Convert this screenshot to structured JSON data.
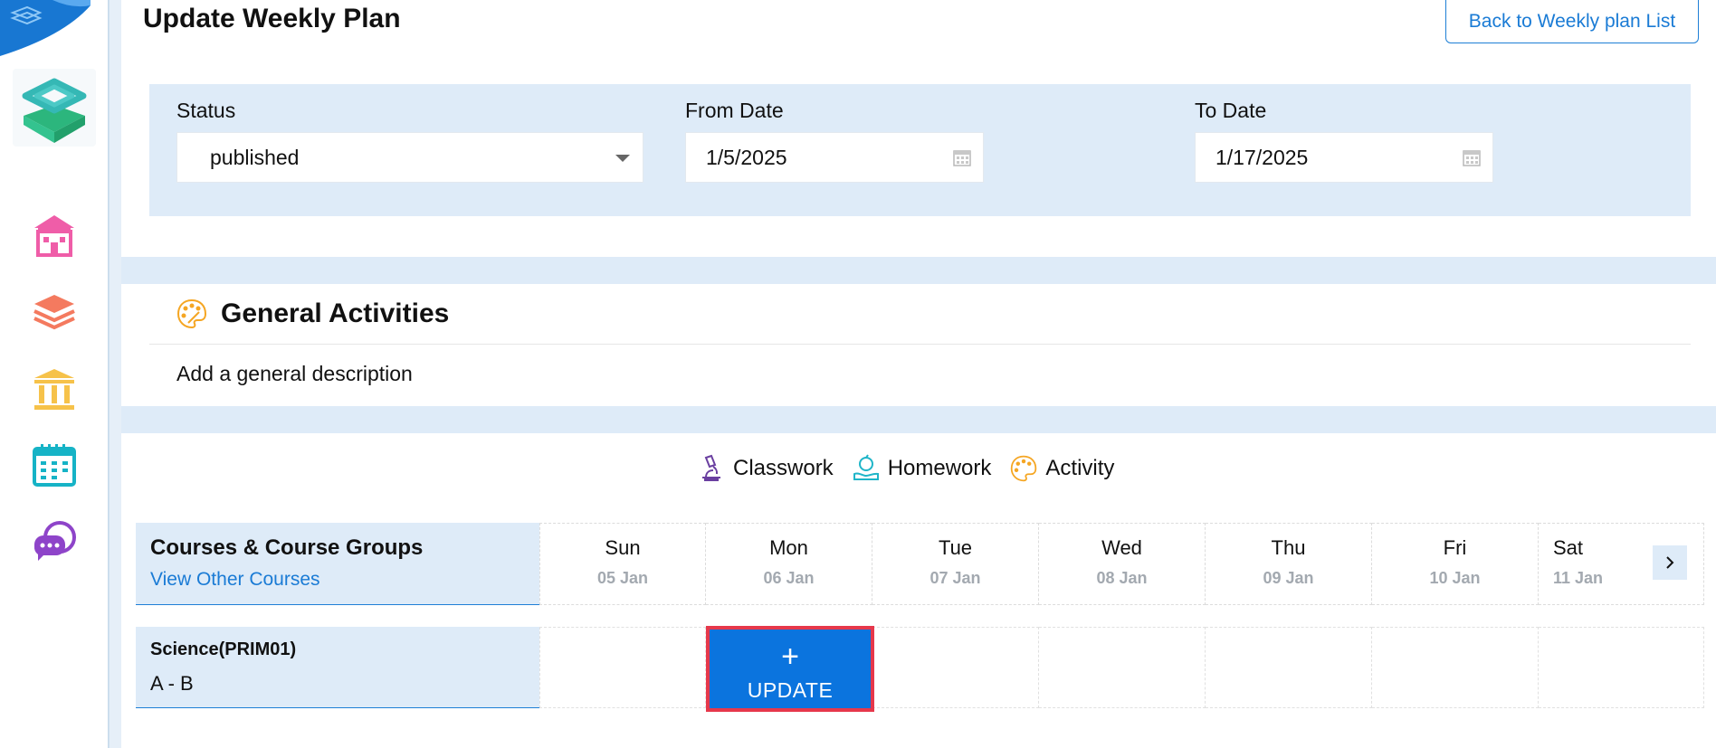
{
  "header": {
    "title": "Update Weekly Plan",
    "back_label": "Back to Weekly plan List"
  },
  "filters": {
    "status_label": "Status",
    "status_value": "published",
    "from_label": "From Date",
    "from_value": "1/5/2025",
    "to_label": "To Date",
    "to_value": "1/17/2025"
  },
  "general": {
    "title": "General Activities",
    "description": "Add a general description"
  },
  "legend": {
    "classwork": "Classwork",
    "homework": "Homework",
    "activity": "Activity"
  },
  "schedule": {
    "courses_title": "Courses & Course Groups",
    "view_other": "View Other Courses",
    "days": [
      {
        "name": "Sun",
        "date": "05 Jan"
      },
      {
        "name": "Mon",
        "date": "06 Jan"
      },
      {
        "name": "Tue",
        "date": "07 Jan"
      },
      {
        "name": "Wed",
        "date": "08 Jan"
      },
      {
        "name": "Thu",
        "date": "09 Jan"
      },
      {
        "name": "Fri",
        "date": "10 Jan"
      },
      {
        "name": "Sat",
        "date": "11 Jan"
      }
    ],
    "course": {
      "name": "Science(PRIM01)",
      "section": "A - B"
    },
    "update_plus": "+",
    "update_label": "UPDATE"
  },
  "colors": {
    "accent": "#0b74de",
    "panel": "#deebf8",
    "highlight_border": "#e6384b"
  },
  "icons": [
    "school-icon",
    "books-icon",
    "institution-icon",
    "calendar-icon",
    "chat-icon",
    "palette-icon",
    "microscope-icon",
    "apple-hand-icon",
    "chevron-right-icon"
  ]
}
